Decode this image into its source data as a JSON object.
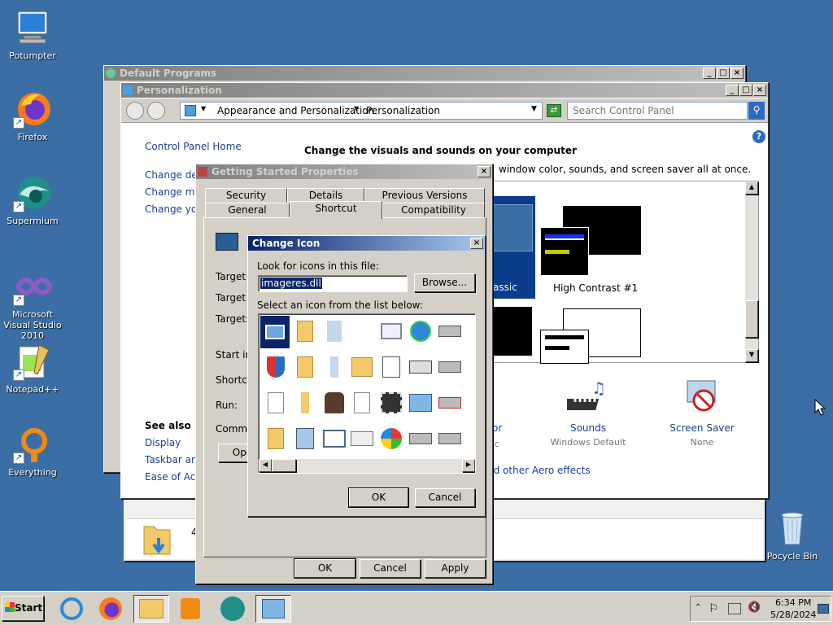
{
  "desktop": {
    "icons": [
      {
        "label": "Potumpter"
      },
      {
        "label": "Firefox"
      },
      {
        "label": "Supermium"
      },
      {
        "label": "Microsoft Visual Studio 2010"
      },
      {
        "label": "Notepad++"
      },
      {
        "label": "Everything"
      },
      {
        "label": "Pocycle Bin"
      }
    ]
  },
  "default_programs": {
    "title": "Default Programs"
  },
  "personalization": {
    "title": "Personalization",
    "breadcrumb": [
      "Appearance and Personalization",
      "Personalization"
    ],
    "search_placeholder": "Search Control Panel",
    "heading": "Change the visuals and sounds on your computer",
    "subheading_visible": "window color, sounds, and screen saver all at once.",
    "sidebar": {
      "home": "Control Panel Home",
      "links": [
        "Change desk",
        "Change mous",
        "Change your"
      ],
      "see_also": "See also",
      "see_also_links": [
        "Display",
        "Taskbar and",
        "Ease of Acce"
      ]
    },
    "themes": [
      {
        "label": "assic"
      },
      {
        "label": "High Contrast #1"
      }
    ],
    "bottom_items": [
      {
        "label": "or",
        "sub": "sic"
      },
      {
        "label": "Sounds",
        "sub": "Windows Default"
      },
      {
        "label": "Screen Saver",
        "sub": "None"
      }
    ],
    "aero_link": "nd other Aero effects"
  },
  "lower_window": {
    "text": "4"
  },
  "properties": {
    "title": "Getting Started Properties",
    "tabs_row1": [
      "Security",
      "Details",
      "Previous Versions"
    ],
    "tabs_row2": [
      "General",
      "Shortcut",
      "Compatibility"
    ],
    "fields": [
      "Target ty",
      "Target lo",
      "Target:",
      "Start in:",
      "Shortcut",
      "Run:",
      "Commen"
    ],
    "open_btn": "Ope",
    "ok": "OK",
    "cancel": "Cancel",
    "apply": "Apply"
  },
  "change_icon": {
    "title": "Change Icon",
    "look_label": "Look for icons in this file:",
    "file_value": "imageres.dll",
    "browse": "Browse...",
    "select_label": "Select an icon from the list below:",
    "ok": "OK",
    "cancel": "Cancel"
  },
  "taskbar": {
    "start": "Start",
    "time": "6:34 PM",
    "date": "5/28/2024"
  },
  "colors": {
    "desktop": "#3a6ea5",
    "active_title": "#0a246a",
    "link": "#1c3f94"
  }
}
